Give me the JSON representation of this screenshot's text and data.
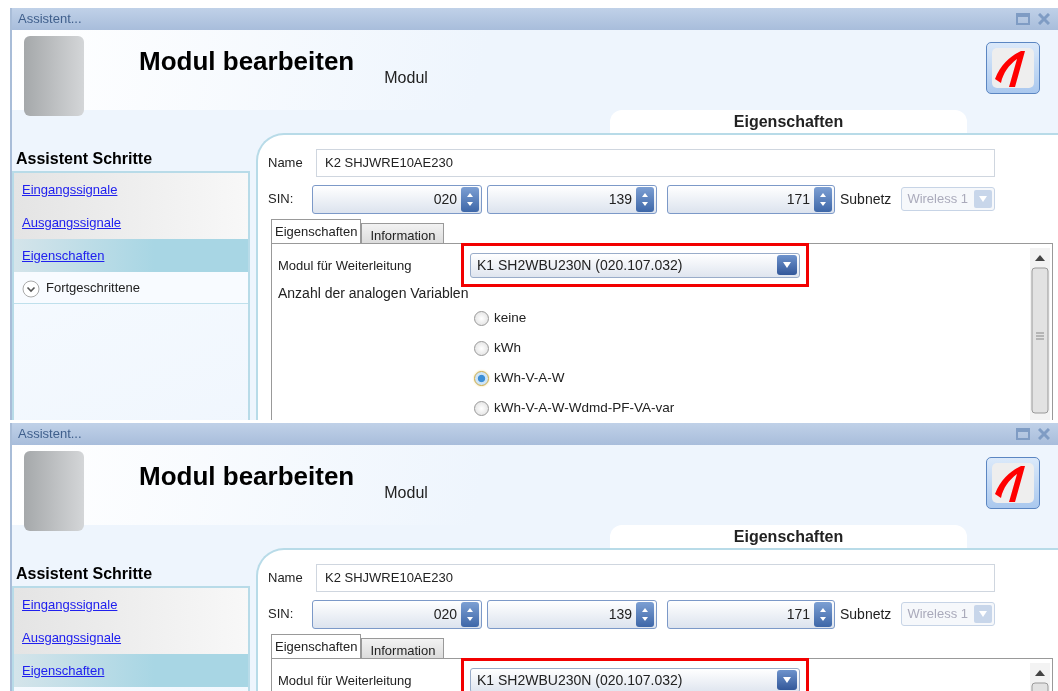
{
  "windows": [
    {
      "title": "Assistent...",
      "heading": "Modul bearbeiten",
      "subheading": "Modul",
      "section_title": "Eigenschaften",
      "steps_title": "Assistent Schritte",
      "steps": [
        {
          "kind": "link",
          "label": "Eingangssignale",
          "selected": false
        },
        {
          "kind": "link",
          "label": "Ausgangssignale",
          "selected": false
        },
        {
          "kind": "link",
          "label": "Eigenschaften",
          "selected": true
        },
        {
          "kind": "expander",
          "label": "Fortgeschrittene",
          "selected": false
        }
      ],
      "name_label": "Name",
      "name_value": "K2 SHJWRE10AE230",
      "sin_label": "SIN:",
      "sin": [
        "020",
        "139",
        "171"
      ],
      "subnet_label": "Subnetz",
      "subnet_value": "Wireless 1",
      "subnet_disabled": true,
      "tabs": [
        {
          "label": "Eigenschaften",
          "selected": true
        },
        {
          "label": "Information",
          "selected": false
        }
      ],
      "forward_label": "Modul für Weiterleitung",
      "forward_value": "K1 SH2WBU230N (020.107.032)",
      "highlighted": true,
      "analog_label": "Anzahl der analogen Variablen",
      "options": [
        {
          "label": "keine",
          "selected": false
        },
        {
          "label": "kWh",
          "selected": false
        },
        {
          "label": "kWh-V-A-W",
          "selected": true
        },
        {
          "label": "kWh-V-A-W-Wdmd-PF-VA-var",
          "selected": false
        }
      ]
    },
    {
      "title": "Assistent...",
      "heading": "Modul bearbeiten",
      "subheading": "Modul",
      "section_title": "Eigenschaften",
      "steps_title": "Assistent Schritte",
      "steps": [
        {
          "kind": "link",
          "label": "Eingangssignale",
          "selected": false
        },
        {
          "kind": "link",
          "label": "Ausgangssignale",
          "selected": false
        },
        {
          "kind": "link",
          "label": "Eigenschaften",
          "selected": true
        }
      ],
      "name_label": "Name",
      "name_value": "K2 SHJWRE10AE230",
      "sin_label": "SIN:",
      "sin": [
        "020",
        "139",
        "171"
      ],
      "subnet_label": "Subnetz",
      "subnet_value": "Wireless 1",
      "subnet_disabled": true,
      "tabs": [
        {
          "label": "Eigenschaften",
          "selected": true
        },
        {
          "label": "Information",
          "selected": false
        }
      ],
      "forward_label": "Modul für Weiterleitung",
      "forward_value": "K1 SH2WBU230N (020.107.032)",
      "highlighted": true
    }
  ]
}
